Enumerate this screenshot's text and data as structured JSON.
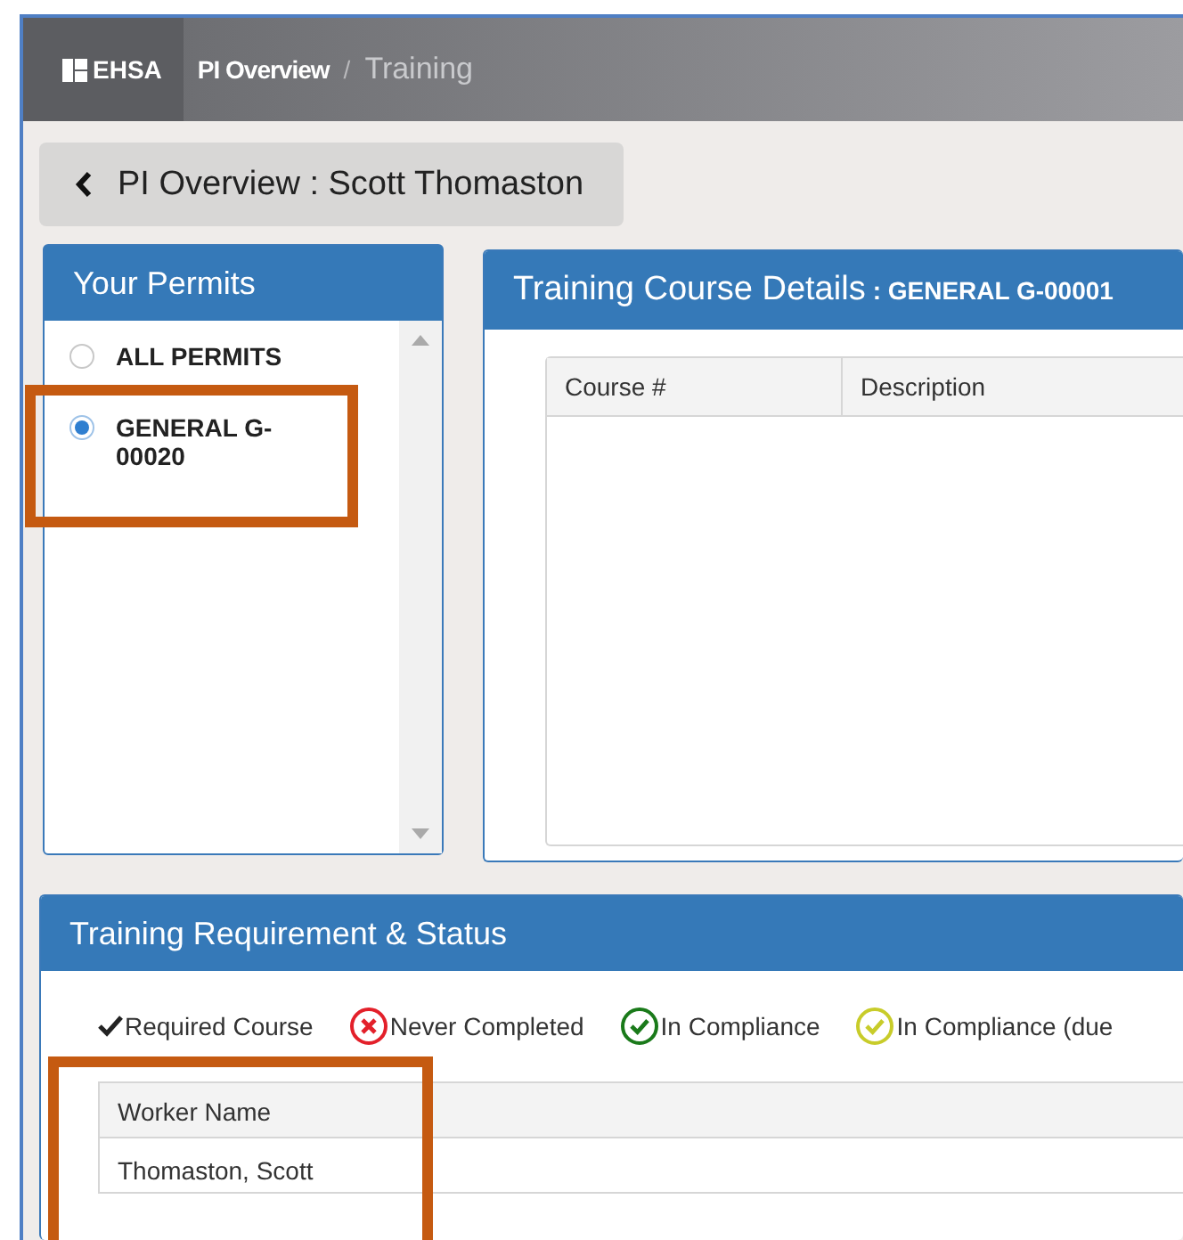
{
  "top_bar": {
    "logo": "EHSA",
    "separator": "/",
    "breadcrumbs": [
      {
        "label": "PI Overview",
        "current": false
      },
      {
        "label": "Training",
        "current": true
      }
    ]
  },
  "back_button": {
    "label": "PI Overview : Scott Thomaston"
  },
  "permits_panel": {
    "title": "Your Permits",
    "items": [
      {
        "label": "ALL PERMITS",
        "selected": false,
        "highlighted": false
      },
      {
        "label": "GENERAL G-00020",
        "selected": true,
        "highlighted": true
      }
    ]
  },
  "course_panel": {
    "title": "Training Course Details",
    "subtitle": ": GENERAL G-00001",
    "columns": [
      "Course #",
      "Description"
    ]
  },
  "requirement_panel": {
    "title": "Training Requirement & Status",
    "legend": [
      {
        "kind": "check",
        "label": "Required Course",
        "color": "#222222"
      },
      {
        "kind": "cross",
        "label": "Never Completed",
        "color": "#e3202a"
      },
      {
        "kind": "circle-check",
        "label": "In Compliance",
        "color": "#1a7a1a"
      },
      {
        "kind": "circle-check",
        "label": "In Compliance (due",
        "color": "#c8cc2a"
      }
    ],
    "table": {
      "columns": [
        {
          "label": "Worker Name",
          "highlighted": true
        }
      ],
      "rows": [
        [
          "Thomaston, Scott"
        ]
      ]
    }
  }
}
